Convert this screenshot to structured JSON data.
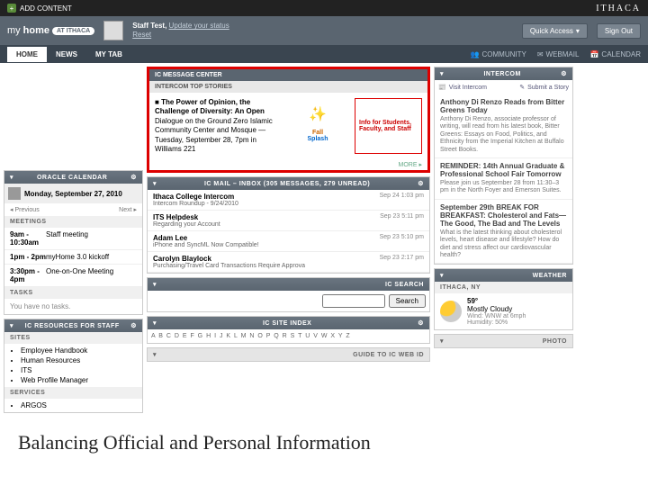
{
  "topbar": {
    "add_content": "ADD CONTENT",
    "brand": "ITHACA"
  },
  "header": {
    "logo_my": "my",
    "logo_home": "home",
    "logo_at": "AT",
    "logo_ithaca": "ITHACA",
    "user_name": "Staff Test,",
    "update_status": "Update your status",
    "reset": "Reset",
    "quick_access": "Quick Access",
    "sign_out": "Sign Out"
  },
  "nav": {
    "tabs": [
      "HOME",
      "NEWS",
      "MY TAB"
    ],
    "right": {
      "community": "COMMUNITY",
      "webmail": "WEBMAIL",
      "calendar": "CALENDAR"
    }
  },
  "msg_center": {
    "title": "IC MESSAGE CENTER",
    "sub": "INTERCOM TOP STORIES",
    "story_title": "The Power of Opinion, the Challenge of Diversity: An Open",
    "story_body": "Dialogue on the Ground Zero Islamic Community Center and Mosque — Tuesday, September 28, 7pm in Williams 221",
    "splash_top": "Fall",
    "splash_bottom": "Splash",
    "info": "Info for Students, Faculty, and Staff",
    "more": "MORE ▸"
  },
  "calendar": {
    "title": "ORACLE CALENDAR",
    "date": "Monday, September 27, 2010",
    "prev": "◂ Previous",
    "next": "Next ▸",
    "meetings_label": "MEETINGS",
    "meetings": [
      {
        "time": "9am - 10:30am",
        "title": "Staff meeting"
      },
      {
        "time": "1pm - 2pm",
        "title": "myHome 3.0 kickoff"
      },
      {
        "time": "3:30pm - 4pm",
        "title": "One-on-One Meeting"
      }
    ],
    "tasks_label": "TASKS",
    "tasks_empty": "You have no tasks."
  },
  "inbox": {
    "title": "IC MAIL – INBOX (305 MESSAGES, 279 UNREAD)",
    "items": [
      {
        "sender": "Ithaca College Intercom",
        "subject": "Intercom Roundup - 9/24/2010",
        "date": "Sep 24 1:03 pm"
      },
      {
        "sender": "ITS Helpdesk",
        "subject": "Regarding your Account",
        "date": "Sep 23 5:11 pm"
      },
      {
        "sender": "Adam Lee",
        "subject": "iPhone and SyncML Now Compatible!",
        "date": "Sep 23 5:10 pm"
      },
      {
        "sender": "Carolyn Blaylock",
        "subject": "Purchasing/Travel Card Transactions Require Approva",
        "date": "Sep 23 2:17 pm"
      }
    ]
  },
  "search": {
    "title": "IC SEARCH",
    "placeholder": "",
    "button": "Search"
  },
  "site_index": {
    "title": "IC SITE INDEX",
    "alpha": "A B C D E F G H I J K L M N O P Q R S T U V W X Y Z"
  },
  "guide": {
    "title": "GUIDE TO IC WEB ID"
  },
  "resources": {
    "title": "IC RESOURCES FOR STAFF",
    "sites_label": "SITES",
    "sites": [
      "Employee Handbook",
      "Human Resources",
      "ITS",
      "Web Profile Manager"
    ],
    "services_label": "SERVICES",
    "services": [
      "ARGOS"
    ]
  },
  "intercom": {
    "title": "INTERCOM",
    "visit": "Visit Intercom",
    "submit": "Submit a Story",
    "items": [
      {
        "title": "Anthony Di Renzo Reads from Bitter Greens Today",
        "body": "Anthony Di Renzo, associate professor of writing, will read from his latest book, Bitter Greens: Essays on Food, Politics, and Ethnicity from the Imperial Kitchen at Buffalo Street Books."
      },
      {
        "title": "REMINDER: 14th Annual Graduate & Professional School Fair Tomorrow",
        "body": "Please join us September 28 from 11:30–3 pm in the North Foyer and Emerson Suites."
      },
      {
        "title": "September 29th BREAK FOR BREAKFAST: Cholesterol and Fats—The Good, The Bad and The Levels",
        "body": "What is the latest thinking about cholesterol levels, heart disease and lifestyle? How do diet and stress affect our cardiovascular health?"
      }
    ]
  },
  "weather": {
    "title": "WEATHER",
    "location": "ITHACA, NY",
    "temp": "59°",
    "cond": "Mostly Cloudy",
    "wind": "Wind: WNW at 6mph",
    "humidity": "Humidity: 50%"
  },
  "photo": {
    "title": "PHOTO"
  },
  "caption": "Balancing Official and Personal Information"
}
